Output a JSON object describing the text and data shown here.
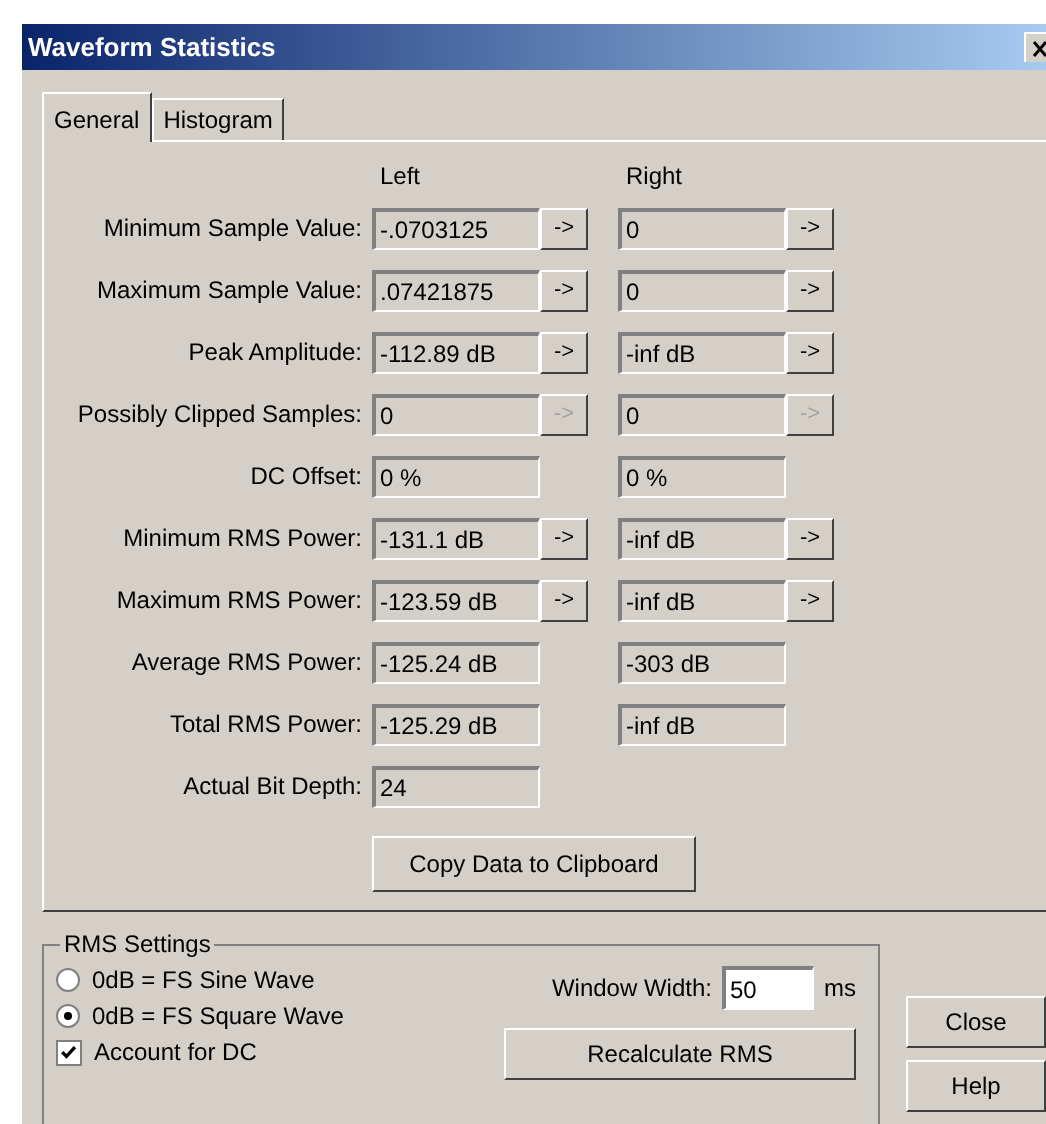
{
  "window": {
    "title": "Waveform Statistics"
  },
  "tabs": [
    {
      "label": "General",
      "selected": true
    },
    {
      "label": "Histogram",
      "selected": false
    }
  ],
  "columns": [
    "Left",
    "Right"
  ],
  "rows": [
    {
      "label": "Minimum Sample Value:",
      "left": {
        "value": "-.0703125",
        "button": {
          "label": "->",
          "disabled": false
        }
      },
      "right": {
        "value": "0",
        "button": {
          "label": "->",
          "disabled": false
        }
      }
    },
    {
      "label": "Maximum Sample Value:",
      "left": {
        "value": ".07421875",
        "button": {
          "label": "->",
          "disabled": false
        }
      },
      "right": {
        "value": "0",
        "button": {
          "label": "->",
          "disabled": false
        }
      }
    },
    {
      "label": "Peak Amplitude:",
      "left": {
        "value": "-112.89 dB",
        "button": {
          "label": "->",
          "disabled": false
        }
      },
      "right": {
        "value": "-inf dB",
        "button": {
          "label": "->",
          "disabled": false
        }
      }
    },
    {
      "label": "Possibly Clipped Samples:",
      "left": {
        "value": "0",
        "button": {
          "label": "->",
          "disabled": true
        }
      },
      "right": {
        "value": "0",
        "button": {
          "label": "->",
          "disabled": true
        }
      }
    },
    {
      "label": "DC Offset:",
      "left": {
        "value": "0 %"
      },
      "right": {
        "value": "0 %"
      }
    },
    {
      "label": "Minimum RMS Power:",
      "left": {
        "value": "-131.1 dB",
        "button": {
          "label": "->",
          "disabled": false
        }
      },
      "right": {
        "value": "-inf dB",
        "button": {
          "label": "->",
          "disabled": false
        }
      }
    },
    {
      "label": "Maximum RMS Power:",
      "left": {
        "value": "-123.59 dB",
        "button": {
          "label": "->",
          "disabled": false
        }
      },
      "right": {
        "value": "-inf dB",
        "button": {
          "label": "->",
          "disabled": false
        }
      }
    },
    {
      "label": "Average RMS Power:",
      "left": {
        "value": "-125.24 dB"
      },
      "right": {
        "value": "-303 dB"
      }
    },
    {
      "label": "Total RMS Power:",
      "left": {
        "value": "-125.29 dB"
      },
      "right": {
        "value": "-inf dB"
      }
    },
    {
      "label": "Actual Bit Depth:",
      "left": {
        "value": "24"
      }
    }
  ],
  "copy_button": "Copy Data to Clipboard",
  "rms_settings": {
    "title": "RMS Settings",
    "options": [
      {
        "label": "0dB = FS Sine Wave",
        "selected": false
      },
      {
        "label": "0dB = FS Square Wave",
        "selected": true
      }
    ],
    "account_for_dc": {
      "label": "Account for DC",
      "checked": true
    },
    "window_width": {
      "label": "Window Width:",
      "value": "50",
      "unit": "ms"
    },
    "recalculate_button": "Recalculate RMS"
  },
  "buttons": [
    "Close",
    "Help"
  ]
}
